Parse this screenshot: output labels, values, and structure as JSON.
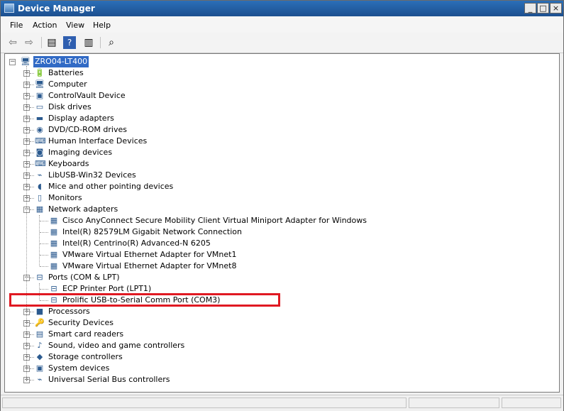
{
  "window": {
    "title": "Device Manager"
  },
  "menu": {
    "file": "File",
    "action": "Action",
    "view": "View",
    "help": "Help"
  },
  "toolbar": {
    "buttons": [
      "back-icon",
      "forward-icon",
      "properties-icon",
      "help-icon",
      "console-icon",
      "scan-hardware-icon"
    ]
  },
  "tree": {
    "root": "ZRO04-LT400",
    "categories": [
      {
        "label": "Batteries",
        "icon": "battery-icon",
        "expanded": false
      },
      {
        "label": "Computer",
        "icon": "computer-icon",
        "expanded": false
      },
      {
        "label": "ControlVault Device",
        "icon": "controlvault-icon",
        "expanded": false
      },
      {
        "label": "Disk drives",
        "icon": "disk-icon",
        "expanded": false
      },
      {
        "label": "Display adapters",
        "icon": "display-icon",
        "expanded": false
      },
      {
        "label": "DVD/CD-ROM drives",
        "icon": "dvd-icon",
        "expanded": false
      },
      {
        "label": "Human Interface Devices",
        "icon": "hid-icon",
        "expanded": false
      },
      {
        "label": "Imaging devices",
        "icon": "camera-icon",
        "expanded": false
      },
      {
        "label": "Keyboards",
        "icon": "keyboard-icon",
        "expanded": false
      },
      {
        "label": "LibUSB-Win32 Devices",
        "icon": "usb-icon",
        "expanded": false
      },
      {
        "label": "Mice and other pointing devices",
        "icon": "mouse-icon",
        "expanded": false
      },
      {
        "label": "Monitors",
        "icon": "monitor-icon",
        "expanded": false
      },
      {
        "label": "Network adapters",
        "icon": "network-icon",
        "expanded": true,
        "children": [
          "Cisco AnyConnect Secure Mobility Client Virtual Miniport Adapter for Windows",
          "Intel(R) 82579LM Gigabit Network Connection",
          "Intel(R) Centrino(R) Advanced-N 6205",
          "VMware Virtual Ethernet Adapter for VMnet1",
          "VMware Virtual Ethernet Adapter for VMnet8"
        ]
      },
      {
        "label": "Ports (COM & LPT)",
        "icon": "port-icon",
        "expanded": true,
        "children": [
          "ECP Printer Port (LPT1)",
          "Prolific USB-to-Serial Comm Port (COM3)"
        ]
      },
      {
        "label": "Processors",
        "icon": "processor-icon",
        "expanded": false
      },
      {
        "label": "Security Devices",
        "icon": "security-icon",
        "expanded": false
      },
      {
        "label": "Smart card readers",
        "icon": "smartcard-icon",
        "expanded": false
      },
      {
        "label": "Sound, video and game controllers",
        "icon": "sound-icon",
        "expanded": false
      },
      {
        "label": "Storage controllers",
        "icon": "storage-icon",
        "expanded": false
      },
      {
        "label": "System devices",
        "icon": "system-icon",
        "expanded": false
      },
      {
        "label": "Universal Serial Bus controllers",
        "icon": "usb-controller-icon",
        "expanded": false
      }
    ]
  },
  "colors": {
    "highlight_box": "#e01922",
    "selection": "#316ac5",
    "titlebar": "#2b6fb8"
  }
}
